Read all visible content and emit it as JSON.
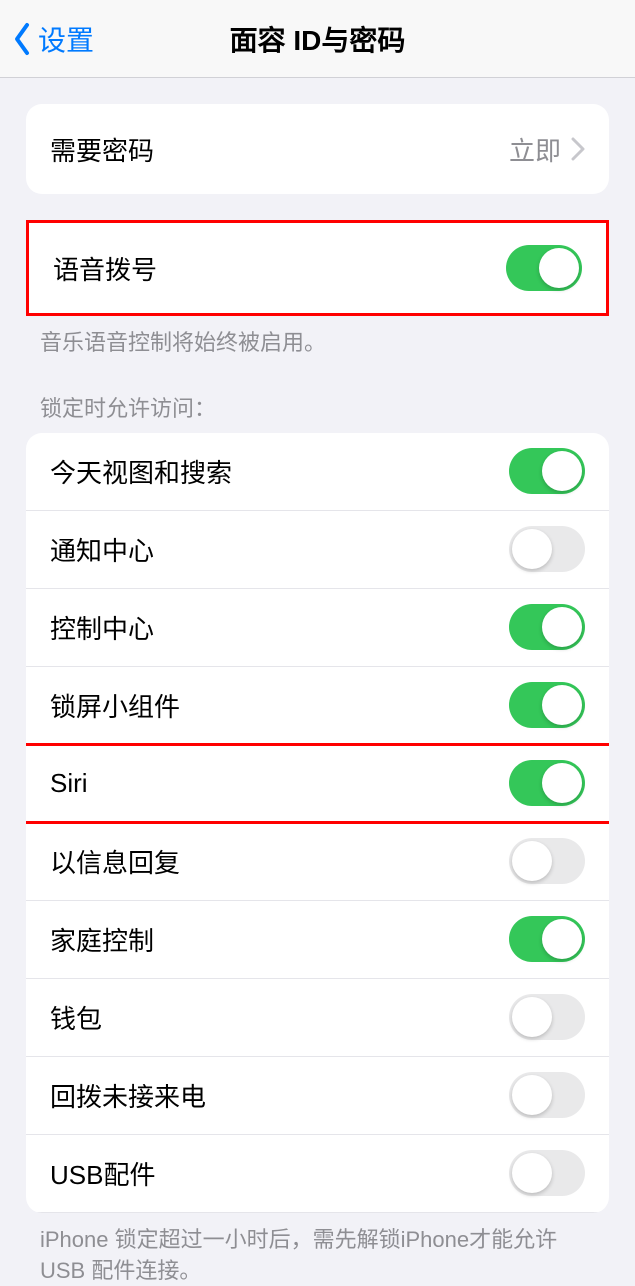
{
  "nav": {
    "back_label": "设置",
    "title": "面容 ID与密码"
  },
  "require_passcode": {
    "label": "需要密码",
    "value": "立即"
  },
  "voice_dial": {
    "label": "语音拨号",
    "note": "音乐语音控制将始终被启用。",
    "on": true
  },
  "lock_section_header": "锁定时允许访问：",
  "lock_items": [
    {
      "label": "今天视图和搜索",
      "on": true,
      "highlight": false
    },
    {
      "label": "通知中心",
      "on": false,
      "highlight": false
    },
    {
      "label": "控制中心",
      "on": true,
      "highlight": false
    },
    {
      "label": "锁屏小组件",
      "on": true,
      "highlight": false
    },
    {
      "label": "Siri",
      "on": true,
      "highlight": true
    },
    {
      "label": "以信息回复",
      "on": false,
      "highlight": false
    },
    {
      "label": "家庭控制",
      "on": true,
      "highlight": false
    },
    {
      "label": "钱包",
      "on": false,
      "highlight": false
    },
    {
      "label": "回拨未接来电",
      "on": false,
      "highlight": false
    },
    {
      "label": "USB配件",
      "on": false,
      "highlight": false
    }
  ],
  "usb_note": "iPhone 锁定超过一小时后，需先解锁iPhone才能允许USB 配件连接。"
}
